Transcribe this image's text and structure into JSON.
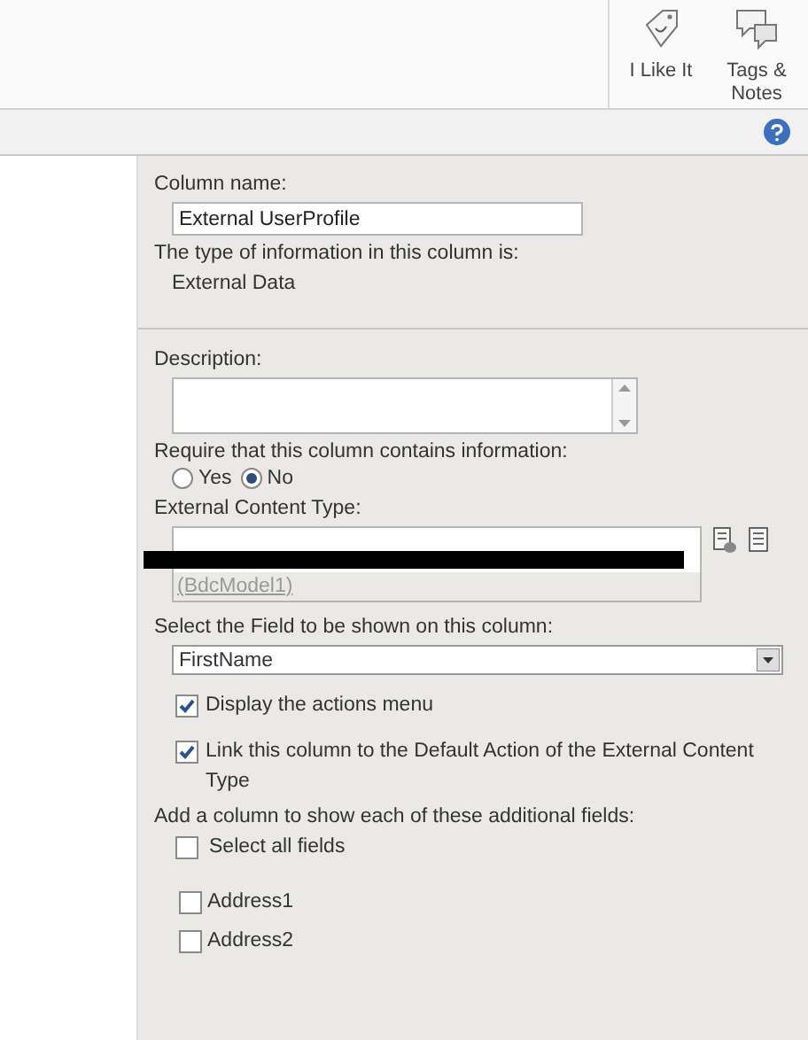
{
  "ribbon": {
    "buttons": [
      {
        "label": "I Like It",
        "kind": "like"
      },
      {
        "label": "Tags &\nNotes",
        "kind": "tags"
      }
    ]
  },
  "column_name": {
    "label": "Column name:",
    "value": "External UserProfile"
  },
  "type_info": {
    "label": "The type of information in this column is:",
    "value": "External Data"
  },
  "description": {
    "label": "Description:"
  },
  "require": {
    "label": "Require that this column contains information:",
    "options": [
      {
        "label": "Yes",
        "selected": false
      },
      {
        "label": "No",
        "selected": true
      }
    ]
  },
  "external_content_type": {
    "label": "External Content Type:",
    "model": "(BdcModel1)"
  },
  "field_select": {
    "label": "Select the Field to be shown on this column:",
    "value": "FirstName"
  },
  "options": [
    {
      "label": "Display the actions menu",
      "checked": true
    },
    {
      "label": "Link this column to the Default Action of the External Content Type",
      "checked": true
    }
  ],
  "additional_fields": {
    "label": "Add a column to show each of these additional fields:",
    "select_all": {
      "label": "Select all fields",
      "checked": false
    },
    "fields": [
      {
        "label": "Address1",
        "checked": false
      },
      {
        "label": "Address2",
        "checked": false
      }
    ]
  }
}
